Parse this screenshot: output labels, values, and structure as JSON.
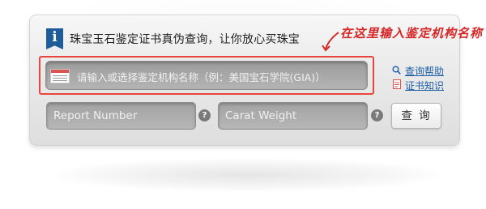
{
  "header": {
    "info_icon_glyph": "i",
    "title": "珠宝玉石鉴定证书真伪查询，让你放心买珠宝"
  },
  "annotation": {
    "text": "在这里输入鉴定机构名称",
    "color": "#d62828"
  },
  "org_search": {
    "placeholder": "请输入或选择鉴定机构名称（例：美国宝石学院(GIA)）",
    "icon": "table-icon"
  },
  "links": {
    "help": "查询帮助",
    "knowledge": "证书知识"
  },
  "form": {
    "report_number_placeholder": "Report Number",
    "carat_weight_placeholder": "Carat Weight",
    "help_glyph": "?",
    "submit_label": "查 询"
  },
  "colors": {
    "accent_blue": "#1e5c9a",
    "link_blue": "#1f5fa8",
    "highlight_red": "#e8453c"
  }
}
